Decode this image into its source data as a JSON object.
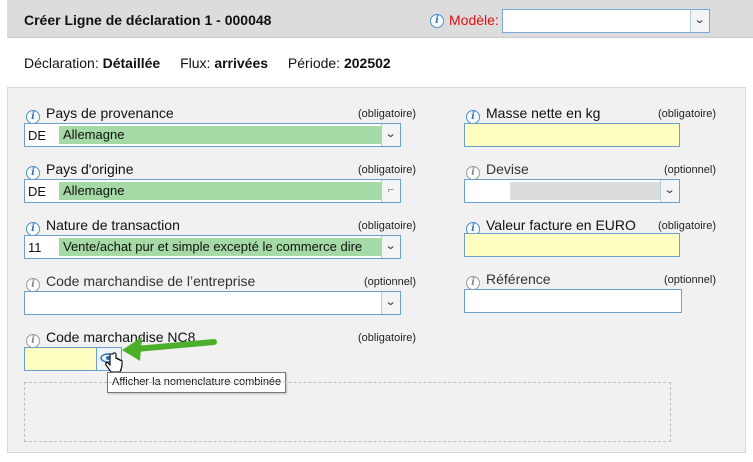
{
  "header": {
    "title": "Créer Ligne de déclaration 1 - 000048",
    "modele_label": "Modèle:",
    "modele_value": ""
  },
  "meta": {
    "declaration_label": "Déclaration:",
    "declaration_value": "Détaillée",
    "flux_label": "Flux:",
    "flux_value": "arrivées",
    "periode_label": "Période:",
    "periode_value": "202502"
  },
  "left": {
    "pays_provenance": {
      "label": "Pays de provenance",
      "req": "(obligatoire)",
      "code": "DE",
      "value": "Allemagne"
    },
    "pays_origine": {
      "label": "Pays d'origine",
      "req": "(obligatoire)",
      "code": "DE",
      "value": "Allemagne"
    },
    "nature_transaction": {
      "label": "Nature de transaction",
      "req": "(obligatoire)",
      "code": "11",
      "value": "Vente/achat pur et simple excepté le commerce dire"
    },
    "code_entreprise": {
      "label": "Code marchandise de l’entreprise",
      "req": "(optionnel)",
      "value": ""
    },
    "code_nc8": {
      "label": "Code marchandise NC8",
      "req": "(obligatoire)",
      "value": ""
    }
  },
  "right": {
    "masse_nette": {
      "label": "Masse nette en kg",
      "req": "(obligatoire)",
      "value": ""
    },
    "devise": {
      "label": "Devise",
      "req": "(optionnel)",
      "value": ""
    },
    "valeur_facture": {
      "label": "Valeur facture en EURO",
      "req": "(obligatoire)",
      "value": ""
    },
    "reference": {
      "label": "Référence",
      "req": "(optionnel)",
      "value": ""
    }
  },
  "tooltip": {
    "text": "Afficher la nomenclature combinée"
  },
  "colors": {
    "required_fill": "#ffffc2",
    "selected_fill": "#a5d9a5",
    "accent": "#d11",
    "arrow": "#4caf2a"
  },
  "icons": [
    "info-icon",
    "chevron-down-icon",
    "eye-icon",
    "hand-cursor-icon",
    "arrow-icon"
  ]
}
